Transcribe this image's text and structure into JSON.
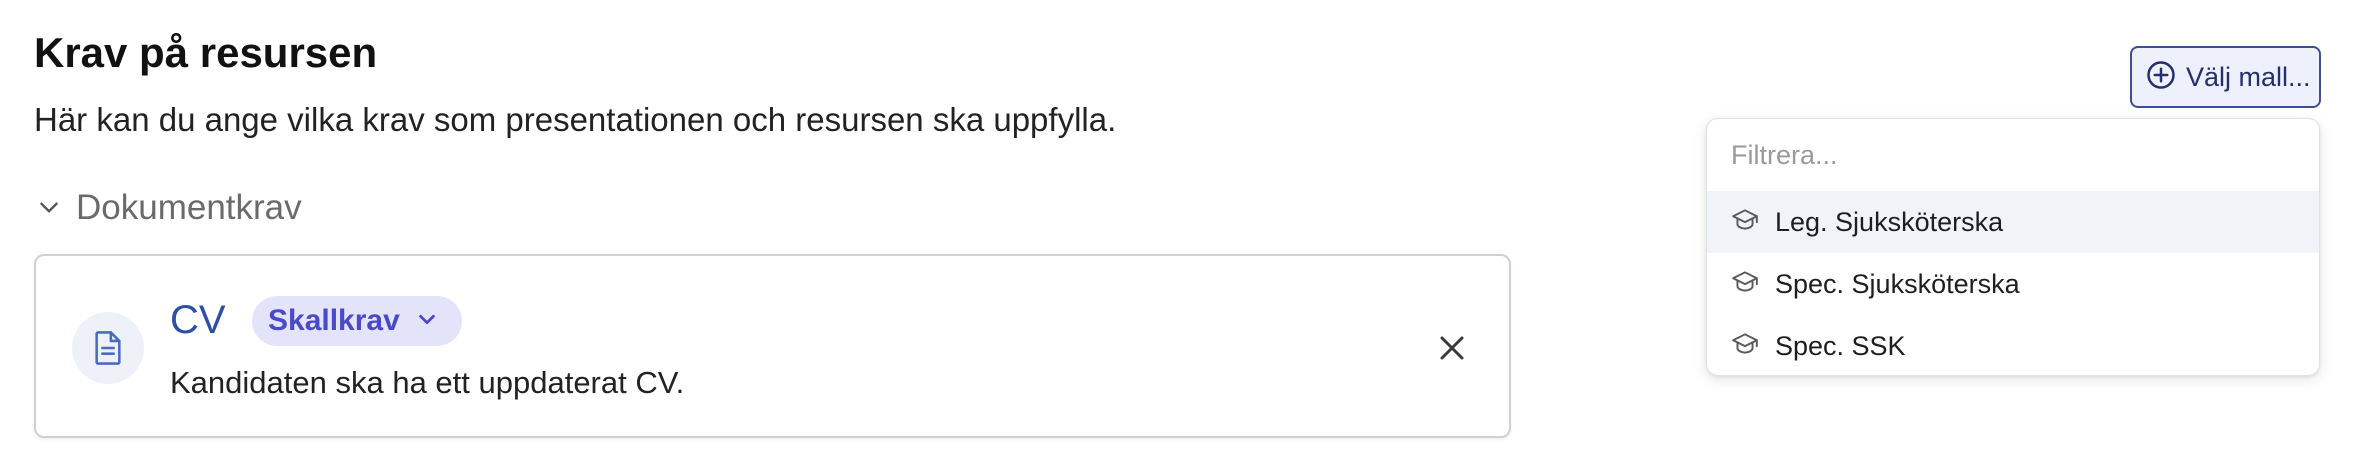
{
  "section": {
    "title": "Krav på resursen",
    "description": "Här kan du ange vilka krav som presentationen och resursen ska uppfylla."
  },
  "group": {
    "label": "Dokumentkrav",
    "expanded": true
  },
  "requirement": {
    "name": "CV",
    "badge_label": "Skallkrav",
    "description": "Kandidaten ska ha ett uppdaterat CV.",
    "icon": "document-icon"
  },
  "template_button": {
    "label": "Välj mall...",
    "icon": "plus-circle-icon"
  },
  "dropdown": {
    "filter_placeholder": "Filtrera...",
    "filter_value": "",
    "options": [
      {
        "label": "Leg. Sjuksköterska",
        "icon": "graduation-cap-icon",
        "highlighted": true
      },
      {
        "label": "Spec. Sjuksköterska",
        "icon": "graduation-cap-icon",
        "highlighted": false
      },
      {
        "label": "Spec. SSK",
        "icon": "graduation-cap-icon",
        "highlighted": false
      }
    ]
  },
  "colors": {
    "accent": "#2e4fa8",
    "badge_bg": "#e3e4f9",
    "badge_text": "#4a49c9",
    "button_border": "#3d4f91",
    "button_bg": "#eef1fb",
    "highlight_bg": "#f0f3f8"
  }
}
